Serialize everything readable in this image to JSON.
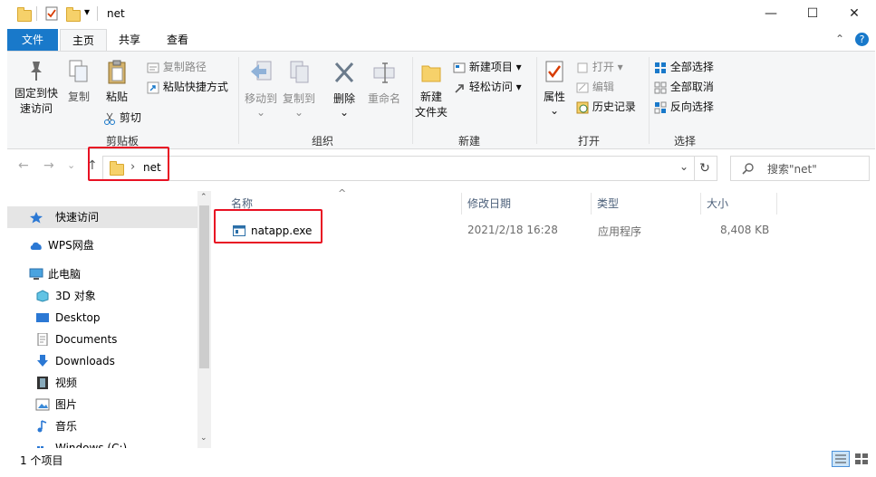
{
  "window": {
    "title": "net",
    "minimize": "—",
    "maximize": "☐",
    "close": "✕",
    "qa_dropdown": "▾"
  },
  "tabs": {
    "file": "文件",
    "home": "主页",
    "share": "共享",
    "view": "查看"
  },
  "ribbon": {
    "collapse": "⌃",
    "help": "?",
    "clipboard": {
      "label": "剪贴板",
      "pin_line1": "固定到快",
      "pin_line2": "速访问",
      "copy": "复制",
      "paste": "粘贴",
      "copy_path": "复制路径",
      "paste_shortcut": "粘贴快捷方式",
      "cut": "剪切"
    },
    "organize": {
      "label": "组织",
      "move_to": "移动到",
      "copy_to": "复制到",
      "delete": "删除",
      "rename": "重命名"
    },
    "new": {
      "label": "新建",
      "new_folder_line1": "新建",
      "new_folder_line2": "文件夹",
      "new_item": "新建项目",
      "easy_access": "轻松访问"
    },
    "open": {
      "label": "打开",
      "properties": "属性",
      "open": "打开",
      "edit": "编辑",
      "history": "历史记录"
    },
    "select": {
      "label": "选择",
      "select_all": "全部选择",
      "select_none": "全部取消",
      "invert": "反向选择"
    }
  },
  "address": {
    "back": "←",
    "forward": "→",
    "recent": "⌄",
    "up": "↑",
    "separator": "›",
    "path": "net",
    "dropdown": "⌄",
    "refresh": "↻",
    "search_placeholder": "搜索\"net\""
  },
  "navpane": {
    "items": [
      {
        "label": "快速访问",
        "icon": "star-icon"
      },
      {
        "label": "WPS网盘",
        "icon": "cloud-icon"
      },
      {
        "label": "此电脑",
        "icon": "computer-icon"
      },
      {
        "label": "3D 对象",
        "icon": "cube-icon"
      },
      {
        "label": "Desktop",
        "icon": "desktop-icon"
      },
      {
        "label": "Documents",
        "icon": "document-icon"
      },
      {
        "label": "Downloads",
        "icon": "download-icon"
      },
      {
        "label": "视频",
        "icon": "video-icon"
      },
      {
        "label": "图片",
        "icon": "picture-icon"
      },
      {
        "label": "音乐",
        "icon": "music-icon"
      },
      {
        "label": "Windows (C:)",
        "icon": "drive-icon"
      }
    ]
  },
  "filelist": {
    "columns": {
      "name": "名称",
      "date": "修改日期",
      "type": "类型",
      "size": "大小"
    },
    "sort_indicator": "^",
    "rows": [
      {
        "name": "natapp.exe",
        "date": "2021/2/18 16:28",
        "type": "应用程序",
        "size": "8,408 KB"
      }
    ]
  },
  "status": {
    "count": "1 个项目"
  },
  "colors": {
    "accent": "#1979ca",
    "highlight": "#e81123",
    "folder": "#f6d16a"
  }
}
